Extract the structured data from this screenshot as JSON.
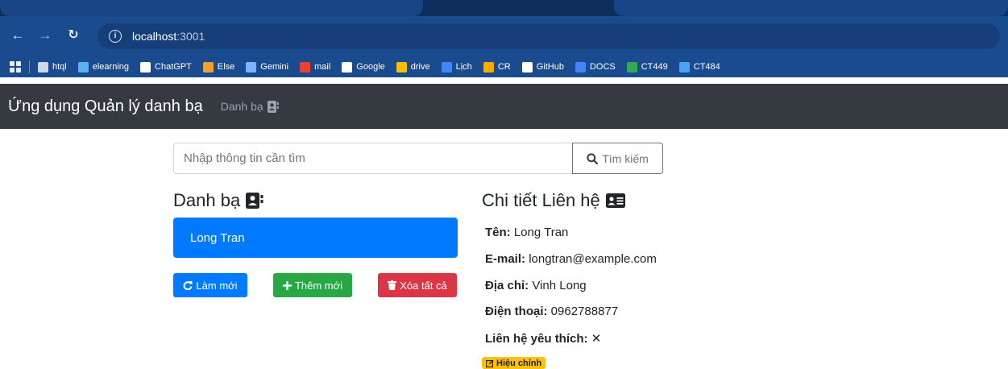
{
  "browser": {
    "url_host": "localhost",
    "url_port": ":3001",
    "bookmarks": [
      {
        "label": "htql",
        "icon": "table-icon",
        "color": "#cfd8e6"
      },
      {
        "label": "elearning",
        "icon": "diamond-icon",
        "color": "#5ab0f0"
      },
      {
        "label": "ChatGPT",
        "icon": "openai-icon",
        "color": "#ffffff"
      },
      {
        "label": "Else",
        "icon": "signal-icon",
        "color": "#f0a030"
      },
      {
        "label": "Gemini",
        "icon": "sparkle-icon",
        "color": "#7fb2ff"
      },
      {
        "label": "mail",
        "icon": "gmail-icon",
        "color": "#ea4335"
      },
      {
        "label": "Google",
        "icon": "google-icon",
        "color": "#ffffff"
      },
      {
        "label": "drive",
        "icon": "drive-icon",
        "color": "#fbbc04"
      },
      {
        "label": "Lịch",
        "icon": "calendar-icon",
        "color": "#4285f4"
      },
      {
        "label": "CR",
        "icon": "classroom-icon",
        "color": "#f9ab00"
      },
      {
        "label": "GitHub",
        "icon": "github-icon",
        "color": "#ffffff"
      },
      {
        "label": "DOCS",
        "icon": "docs-icon",
        "color": "#4285f4"
      },
      {
        "label": "CT449",
        "icon": "drive-icon",
        "color": "#34a853"
      },
      {
        "label": "CT484",
        "icon": "onedrive-icon",
        "color": "#4aa3f5"
      }
    ]
  },
  "navbar": {
    "brand": "Ứng dụng Quản lý danh bạ",
    "link": "Danh bạ"
  },
  "search": {
    "placeholder": "Nhập thông tin cần tìm",
    "button": "Tìm kiếm"
  },
  "contacts": {
    "title": "Danh bạ",
    "items": [
      "Long Tran"
    ],
    "refresh": "Làm mới",
    "add": "Thêm mới",
    "clear": "Xóa tất cả"
  },
  "detail": {
    "title": "Chi tiết Liên hệ",
    "name_label": "Tên:",
    "name": "Long Tran",
    "email_label": "E-mail:",
    "email": "longtran@example.com",
    "address_label": "Địa chỉ:",
    "address": "Vinh Long",
    "phone_label": "Điện thoại:",
    "phone": "0962788877",
    "favorite_label": "Liên hệ yêu thích:",
    "favorite": "✕",
    "edit": "Hiệu chỉnh"
  },
  "colors": {
    "primary": "#007bff",
    "success": "#28a745",
    "danger": "#dc3545",
    "warning": "#ffc107",
    "navbar": "#343a40"
  }
}
